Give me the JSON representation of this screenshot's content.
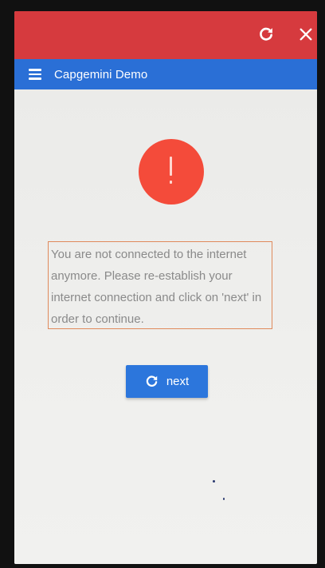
{
  "window": {
    "reload_icon": "reload-icon",
    "close_icon": "close-icon",
    "bar_color": "#d63a3e"
  },
  "appbar": {
    "menu_icon": "hamburger-menu-icon",
    "title": "Capgemini Demo",
    "color": "#2a6fd6"
  },
  "alert": {
    "icon": "exclamation-icon",
    "color": "#f44b3a"
  },
  "message": {
    "text": "You are not connected to the internet anymore. Please re-establish your internet connection and click on 'next' in order to continue."
  },
  "next_button": {
    "icon": "reload-icon",
    "label": "next",
    "color": "#2c76dc"
  }
}
